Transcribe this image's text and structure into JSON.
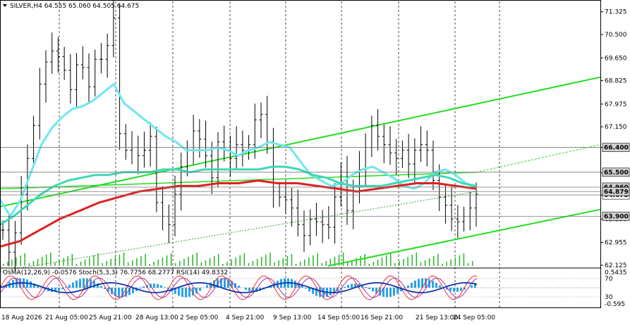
{
  "header": {
    "symbol_line": "SILVER,H4  64.555 65.060 64.505 64.675",
    "indicator_line": "OsMA(12,26,9) -0.0576 Stoch(5,3,3) 76.7756 68.2777 RSI(14) 49.8332"
  },
  "chart_data": {
    "type": "line",
    "title": "SILVER,H4",
    "ohlc": {
      "open": 64.555,
      "high": 65.06,
      "low": 64.505,
      "close": 64.675
    },
    "ylim": [
      62.1,
      71.7
    ],
    "y_ticks": [
      "71.325",
      "70.500",
      "69.650",
      "68.825",
      "67.975",
      "67.150",
      "66.400",
      "65.475",
      "64.675",
      "63.800",
      "62.955",
      "62.125"
    ],
    "level_tags": [
      {
        "label": "66.400",
        "value": 66.4,
        "color": "#d0d0d0"
      },
      {
        "label": "65.500",
        "value": 65.5,
        "color": "#d0d0d0"
      },
      {
        "label": "64.960",
        "value": 64.96,
        "color": "#d0d0d0"
      },
      {
        "label": "64.675",
        "value": 64.675,
        "color": "#ffffff"
      },
      {
        "label": "64.879",
        "value": 64.8,
        "color": "#d0d0d0"
      },
      {
        "label": "63.900",
        "value": 63.9,
        "color": "#d0d0d0"
      }
    ],
    "x_labels": [
      "18 Aug 2026",
      "21 Aug 05:00",
      "25 Aug 21:00",
      "28 Aug 13:00",
      "2 Sep 05:00",
      "4 Sep 21:00",
      "9 Sep 13:00",
      "14 Sep 05:00",
      "16 Sep 21:00",
      "21 Sep 13:00",
      "24 Sep 05:00"
    ],
    "close_series": [
      63.4,
      62.6,
      63.3,
      64.7,
      66.0,
      67.2,
      68.7,
      69.5,
      69.9,
      69.7,
      69.2,
      68.5,
      69.4,
      69.3,
      68.6,
      69.6,
      69.6,
      70.1,
      71.1,
      66.9,
      66.3,
      66.4,
      66.1,
      66.3,
      66.8,
      64.4,
      63.9,
      63.6,
      64.7,
      65.7,
      66.3,
      67.0,
      66.7,
      66.1,
      65.3,
      66.6,
      66.4,
      66.0,
      66.5,
      66.3,
      66.5,
      67.4,
      67.6,
      66.6,
      64.8,
      64.6,
      64.5,
      64.2,
      63.6,
      63.2,
      63.8,
      63.7,
      63.6,
      63.5,
      64.6,
      65.5,
      64.1,
      64.8,
      65.6,
      66.4,
      67.2,
      66.8,
      66.5,
      66.2,
      66.0,
      66.3,
      65.8,
      66.3,
      66.5,
      66.3,
      65.2,
      64.6,
      64.3,
      63.8,
      63.7,
      63.9,
      64.2,
      64.7
    ],
    "series": [
      {
        "name": "",
        "color": "#6ee8f0",
        "values": [
          64.5,
          63.9,
          64.5,
          65.5,
          66.5,
          67.1,
          67.5,
          67.8,
          67.9,
          68.1,
          68.4,
          68.7,
          68.0,
          67.7,
          67.4,
          67.1,
          66.8,
          66.6,
          66.3,
          66.3,
          66.3,
          66.4,
          66.3,
          66.1,
          66.3,
          66.4,
          66.6,
          66.5,
          66.4,
          65.9,
          65.4,
          65.2,
          65.0,
          65.1,
          65.4,
          65.6,
          65.7,
          65.5,
          65.3,
          65.0,
          64.9,
          65.1,
          65.5,
          65.6,
          65.4,
          65.1,
          64.9
        ]
      },
      {
        "name": "",
        "color": "#3ed8b8",
        "values": [
          63.6,
          63.9,
          64.3,
          64.7,
          65.0,
          65.2,
          65.3,
          65.4,
          65.4,
          65.5,
          65.5,
          65.5,
          65.6,
          65.6,
          65.5,
          65.6,
          65.6,
          65.6,
          65.6,
          65.6,
          65.7,
          65.7,
          65.6,
          65.4,
          65.3,
          65.1,
          65.0,
          65.0,
          65.0,
          65.1,
          65.2,
          65.3,
          65.4,
          65.3,
          65.1,
          65.0
        ]
      },
      {
        "name": "",
        "color": "#e02020",
        "values": [
          62.8,
          63.0,
          63.4,
          63.8,
          64.1,
          64.4,
          64.6,
          64.8,
          64.9,
          65.0,
          65.0,
          65.1,
          65.1,
          65.2,
          65.1,
          65.1,
          65.0,
          64.9,
          64.8,
          64.9,
          65.0,
          65.1,
          65.1,
          65.0,
          64.9
        ]
      }
    ],
    "channel_color": "#22dd22",
    "osma": {
      "ylim": [
        -0.595,
        0.5435
      ],
      "y_ticks": [
        "0.5435",
        "70",
        "30",
        "-0.595"
      ],
      "osma_value": -0.0576,
      "stoch_k": 76.7756,
      "stoch_d": 68.2777,
      "rsi": 49.8332
    }
  }
}
